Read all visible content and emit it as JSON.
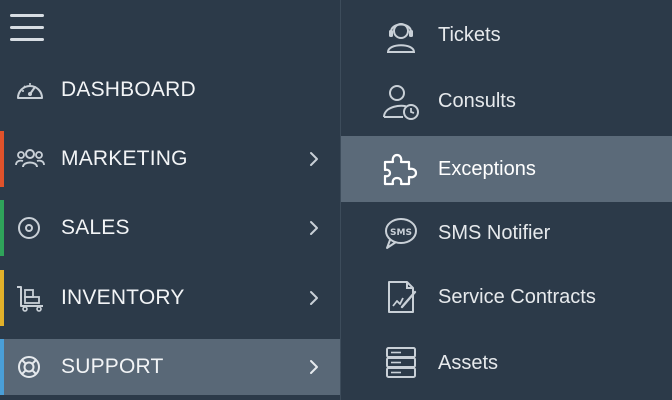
{
  "left_menu": {
    "menu_toggle": "hamburger-menu",
    "items": [
      {
        "label": "DASHBOARD",
        "icon": "gauge-icon",
        "accent": null,
        "has_submenu": false,
        "active": false
      },
      {
        "label": "MARKETING",
        "icon": "users-group-icon",
        "accent": "#e0522b",
        "has_submenu": true,
        "active": false
      },
      {
        "label": "SALES",
        "icon": "target-icon",
        "accent": "#2fa35a",
        "has_submenu": true,
        "active": false
      },
      {
        "label": "INVENTORY",
        "icon": "cart-boxes-icon",
        "accent": "#e2b12a",
        "has_submenu": true,
        "active": false
      },
      {
        "label": "SUPPORT",
        "icon": "lifebuoy-icon",
        "accent": "#4a9fd8",
        "has_submenu": true,
        "active": true
      }
    ]
  },
  "sub_menu": {
    "items": [
      {
        "label": "Tickets",
        "icon": "headset-agent-icon",
        "active": false
      },
      {
        "label": "Consults",
        "icon": "user-clock-icon",
        "active": false
      },
      {
        "label": "Exceptions",
        "icon": "puzzle-icon",
        "active": true
      },
      {
        "label": "SMS Notifier",
        "icon": "sms-bubble-icon",
        "active": false
      },
      {
        "label": "Service Contracts",
        "icon": "contract-pen-icon",
        "active": false
      },
      {
        "label": "Assets",
        "icon": "server-stack-icon",
        "active": false
      }
    ]
  },
  "colors": {
    "background": "#2c3a49",
    "active_background": "#596877",
    "text": "#f2f4f6",
    "icon": "#c9d0d7"
  }
}
